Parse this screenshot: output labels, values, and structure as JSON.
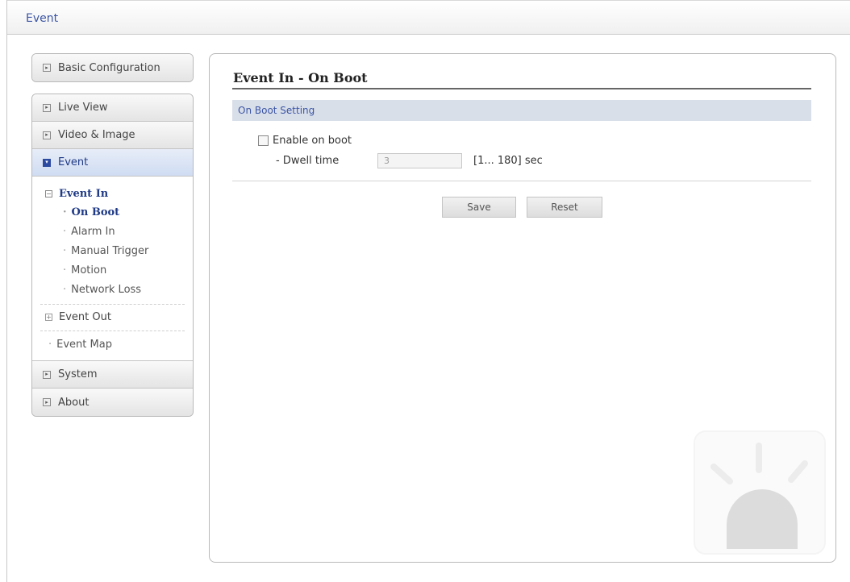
{
  "window": {
    "title": "Event"
  },
  "sidebar": {
    "top": [
      {
        "label": "Basic Configuration"
      }
    ],
    "items": [
      {
        "label": "Live View"
      },
      {
        "label": "Video & Image"
      },
      {
        "label": "Event"
      }
    ],
    "event_sub": {
      "group_label": "Event In",
      "group_toggle": "−",
      "items": [
        {
          "label": "On Boot"
        },
        {
          "label": "Alarm In"
        },
        {
          "label": "Manual Trigger"
        },
        {
          "label": "Motion"
        },
        {
          "label": "Network Loss"
        }
      ],
      "event_out": {
        "label": "Event Out",
        "toggle": "+"
      },
      "event_map": {
        "label": "Event Map"
      }
    },
    "bottom": [
      {
        "label": "System"
      },
      {
        "label": "About"
      }
    ]
  },
  "main": {
    "title": "Event In - On Boot",
    "section_title": "On Boot Setting",
    "enable_label": "Enable on boot",
    "enable_checked": false,
    "dwell_label": "- Dwell time",
    "dwell_value": "3",
    "dwell_range": "[1... 180] sec",
    "save_label": "Save",
    "reset_label": "Reset"
  },
  "colors": {
    "accent": "#3b55a5",
    "nav_active": "#cfdcf2",
    "section_bg": "#d9dfe9"
  },
  "icons": {
    "nav_bullet": "nav-arrow-icon",
    "watermark": "alarm-light-icon"
  }
}
